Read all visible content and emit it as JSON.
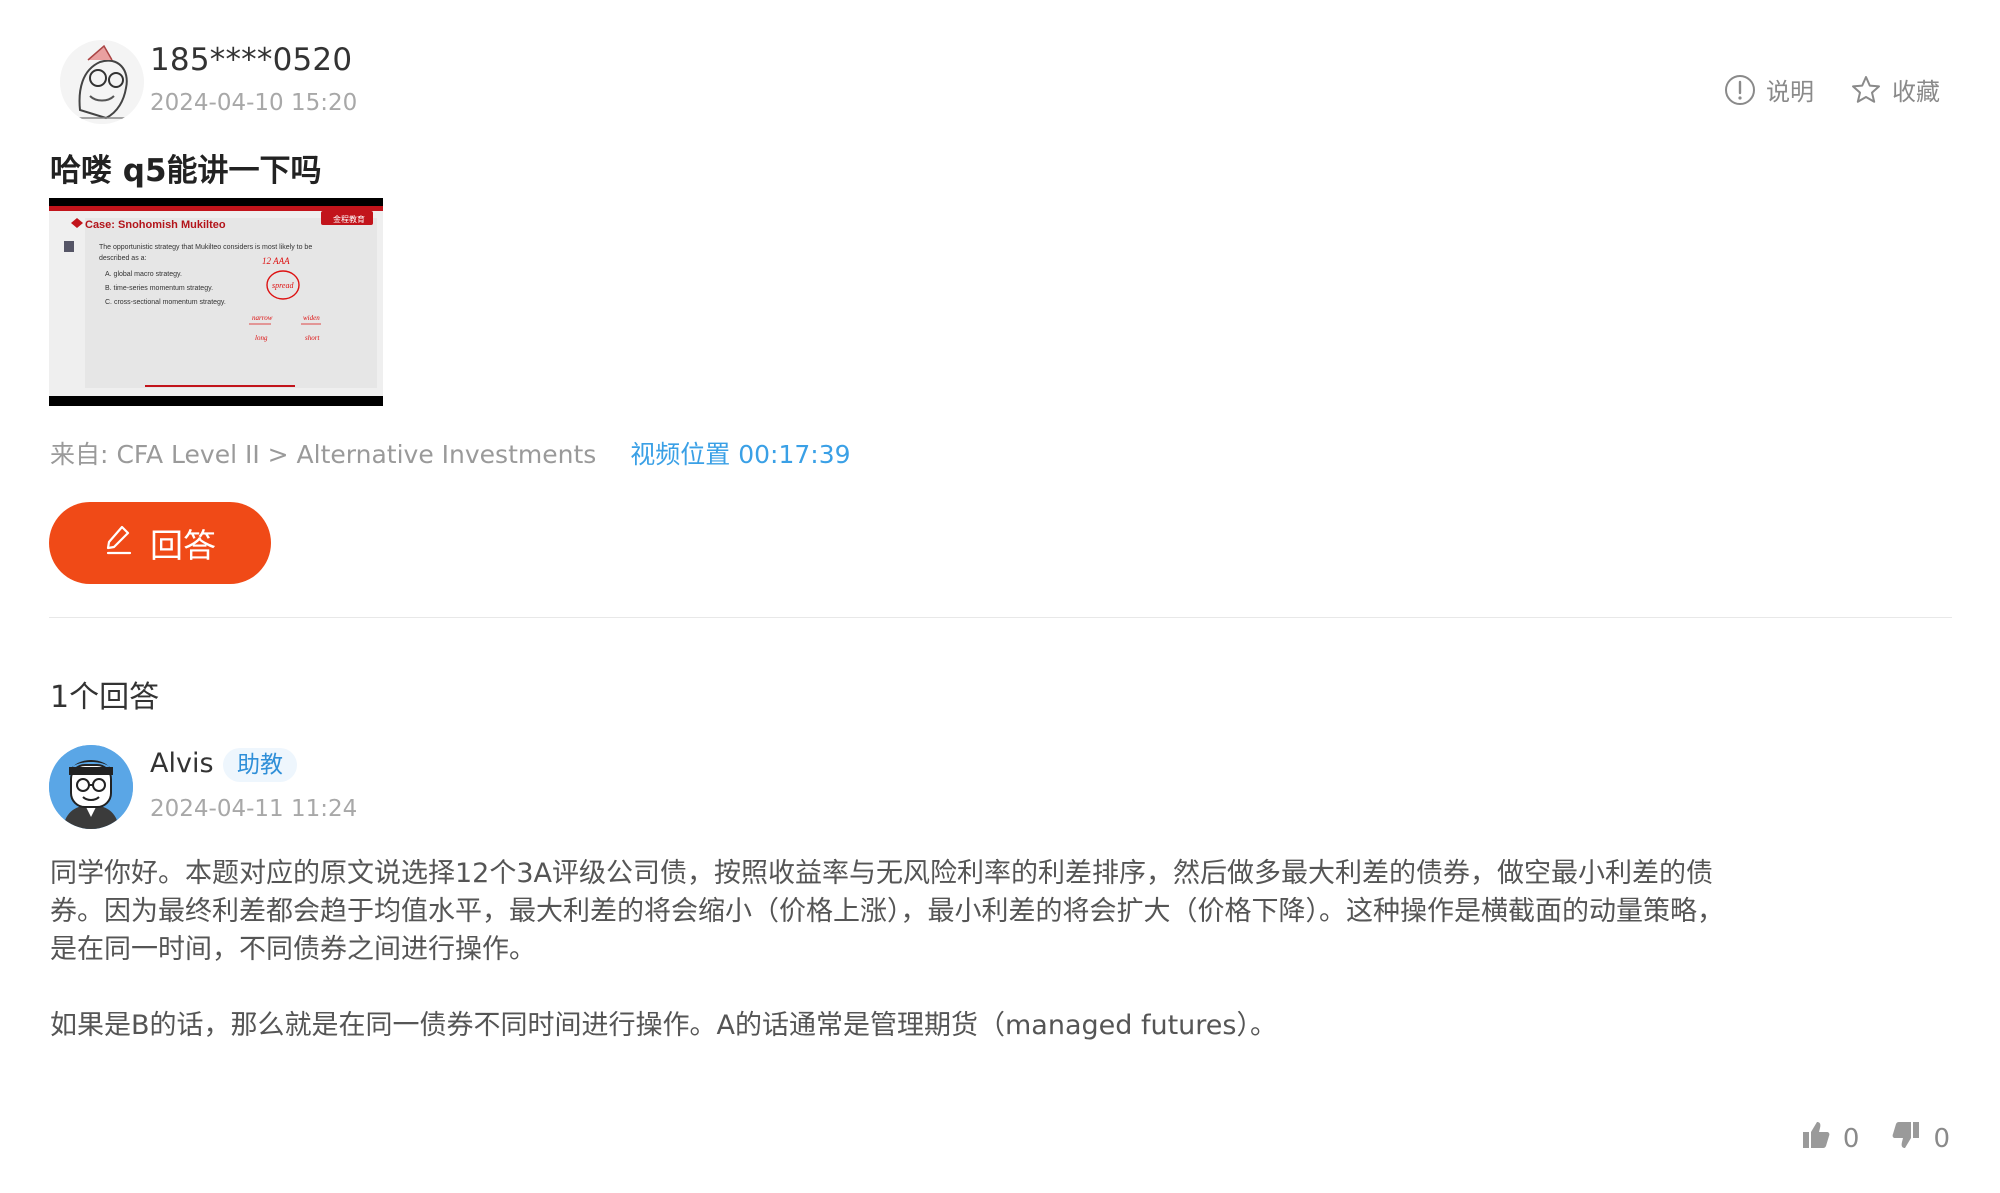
{
  "question": {
    "username": "185****0520",
    "time": "2024-04-10 15:20",
    "title": "哈喽 q5能讲一下吗",
    "thumbnail": {
      "slide_title": "Case: Snohomish Mukilteo",
      "brand": "金程教育",
      "question_line1": "The opportunistic strategy that Mukilteo considers is most likely to be",
      "question_line2": "described as a:",
      "option_a": "A. global macro strategy.",
      "option_b": "B. time-series momentum strategy.",
      "option_c": "C. cross-sectional momentum strategy.",
      "notes": [
        "12 AAA",
        "spread",
        "narrow",
        "widen",
        "long",
        "short"
      ]
    },
    "source_label": "来自:",
    "source_path": "CFA Level II > Alternative Investments",
    "video_position": "视频位置 00:17:39",
    "answer_button": "回答"
  },
  "top_actions": {
    "explain": "说明",
    "favorite": "收藏"
  },
  "answers": {
    "count_label": "1个回答",
    "items": [
      {
        "username": "Alvis",
        "badge": "助教",
        "time": "2024-04-11 11:24",
        "paragraph1": "同学你好。本题对应的原文说选择12个3A评级公司债，按照收益率与无风险利率的利差排序，然后做多最大利差的债券，做空最小利差的债券。因为最终利差都会趋于均值水平，最大利差的将会缩小（价格上涨），最小利差的将会扩大（价格下降）。这种操作是横截面的动量策略，是在同一时间，不同债券之间进行操作。",
        "paragraph2": "如果是B的话，那么就是在同一债券不同时间进行操作。A的话通常是管理期货（managed futures）。",
        "likes": "0",
        "dislikes": "0"
      }
    ]
  },
  "colors": {
    "accent": "#f04a17",
    "link": "#3aa0e6",
    "badge_bg": "#eef6fd"
  }
}
